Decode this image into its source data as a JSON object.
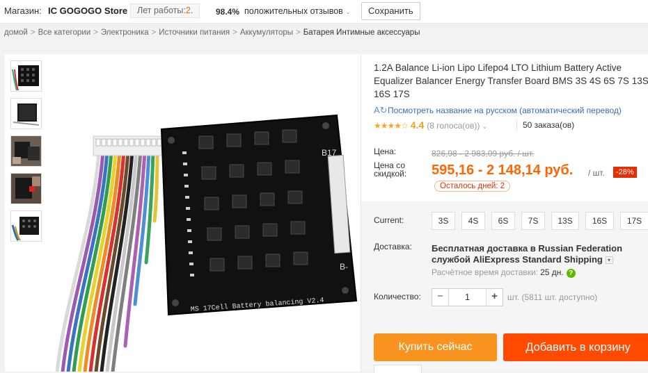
{
  "store": {
    "label": "Магазин:",
    "name": "IC GOGOGO Store",
    "years_label": "Лет работы:",
    "years_value": "2",
    "years_suffix": ".",
    "positive_pct": "98.4%",
    "positive_text": "положительных отзывов",
    "save_label": "Сохранить"
  },
  "breadcrumbs": [
    "домой",
    "Все категории",
    "Электроника",
    "Источники питания",
    "Аккумуляторы",
    "Батарея Интимные аксессуары"
  ],
  "board_text": {
    "caption": "MS 17Cell Battery balancing V2.4",
    "b17": "B17",
    "bminus": "B-"
  },
  "product": {
    "title": "1.2A Balance Li-ion Lipo Lifepo4 LTO Lithium Battery Active Equalizer Balancer Energy Transfer Board BMS 3S 4S 6S 7S 13S 16S 17S",
    "translate_link": "Посмотреть название на русском (автоматический перевод)",
    "rating": "4.4",
    "stars_count": 4.4,
    "votes": "(8 голоса(ов))",
    "orders": "50 заказа(ов)"
  },
  "price": {
    "label": "Цена:",
    "old": "826,98 - 2 983,09 руб. / шт.",
    "discount_label": "Цена со скидкой:",
    "new": "595,16 - 2 148,14 руб.",
    "unit": "/ шт.",
    "discount": "-28%",
    "days_left": "Осталось дней: 2"
  },
  "options": {
    "label": "Current:",
    "values": [
      "3S",
      "4S",
      "6S",
      "7S",
      "13S",
      "16S",
      "17S"
    ]
  },
  "shipping": {
    "label": "Доставка:",
    "text": "Бесплатная доставка в Russian Federation службой AliExpress Standard Shipping",
    "time_label": "Расчётное время доставки:",
    "time_value": "25 дн."
  },
  "quantity": {
    "label": "Количество:",
    "value": "1",
    "available": "шт. (5811 шт. доступно)"
  },
  "actions": {
    "buy": "Купить сейчас",
    "cart": "Добавить в корзину"
  },
  "colors": {
    "accent": "#f60",
    "buy": "#f7931e",
    "cart": "#ff4a00",
    "discount": "#e62e04"
  }
}
